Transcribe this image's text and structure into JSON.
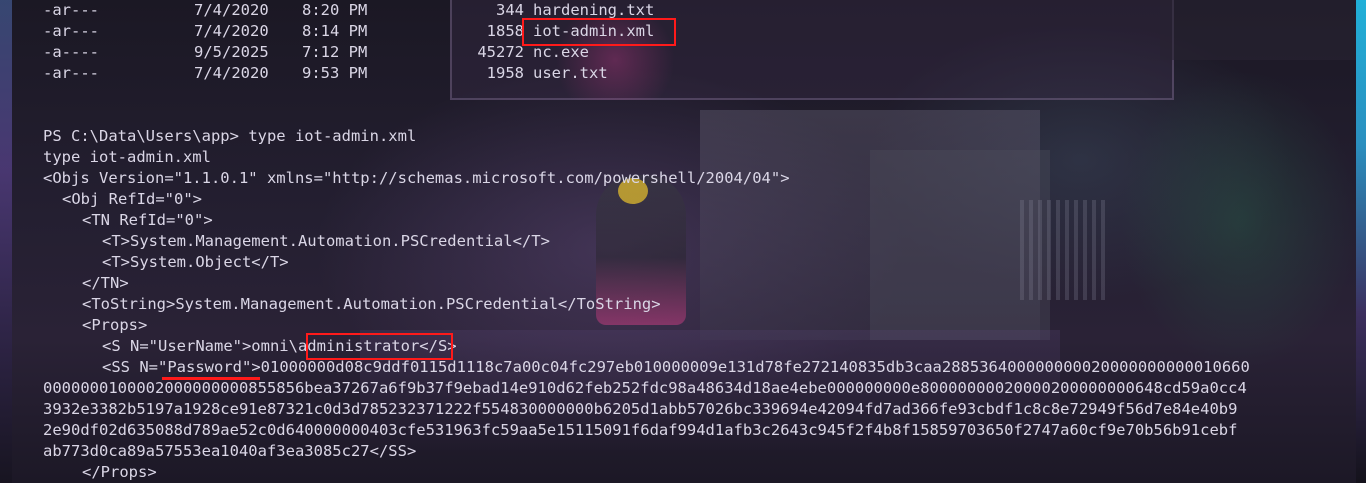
{
  "listing": [
    {
      "mode": "-ar---",
      "date": "7/4/2020",
      "time": "8:20 PM",
      "length": "344",
      "name": "hardening.txt"
    },
    {
      "mode": "-ar---",
      "date": "7/4/2020",
      "time": "8:14 PM",
      "length": "1858",
      "name": "iot-admin.xml"
    },
    {
      "mode": "-a----",
      "date": "9/5/2025",
      "time": "7:12 PM",
      "length": "45272",
      "name": "nc.exe"
    },
    {
      "mode": "-ar---",
      "date": "7/4/2020",
      "time": "9:53 PM",
      "length": "1958",
      "name": "user.txt"
    }
  ],
  "command": {
    "prompt": "PS C:\\Data\\Users\\app> ",
    "input": "type iot-admin.xml",
    "echo": "type iot-admin.xml"
  },
  "xml": {
    "objs_open": "<Objs Version=\"1.1.0.1\" xmlns=\"http://schemas.microsoft.com/powershell/2004/04\">",
    "obj_open": "<Obj RefId=\"0\">",
    "tn_open": "<TN RefId=\"0\">",
    "t1": "<T>System.Management.Automation.PSCredential</T>",
    "t2": "<T>System.Object</T>",
    "tn_close": "</TN>",
    "tostring": "<ToString>System.Management.Automation.PSCredential</ToString>",
    "props_open": "<Props>",
    "username_prefix": "<S N=\"UserName\">omni\\",
    "username_value": "administrator",
    "username_suffix": "</S>",
    "ss_prefix": "<SS N=\"",
    "ss_name": "Password",
    "ss_after_name": "\">",
    "ss_hex_1": "01000000d08c9ddf0115d1118c7a00c04fc297eb010000009e131d78fe272140835db3caa288536400000000020000000000010660",
    "ss_hex_2": "0000000100002000000000855856bea37267a6f9b37f9ebad14e910d62feb252fdc98a48634d18ae4ebe000000000e80000000020000200000000648cd59a0cc4",
    "ss_hex_3": "3932e3382b5197a1928ce91e87321c0d3d785232371222f554830000000b6205d1abb57026bc339694e42094fd7ad366fe93cbdf1c8c8e72949f56d7e84e40b9",
    "ss_hex_4": "2e90df02d635088d789ae52c0d640000000403cfe531963fc59aa5e15115091f6daf994d1afb3c2643c945f2f4b8f15859703650f2747a60cf9e70b56b91cebf",
    "ss_hex_5": "ab773d0ca89a57553ea1040af3ea3085c27",
    "ss_close": "</SS>",
    "props_close": "</Props>"
  },
  "colors": {
    "terminal_text": "#dad6e6",
    "highlight_box": "#ff1a1a"
  }
}
